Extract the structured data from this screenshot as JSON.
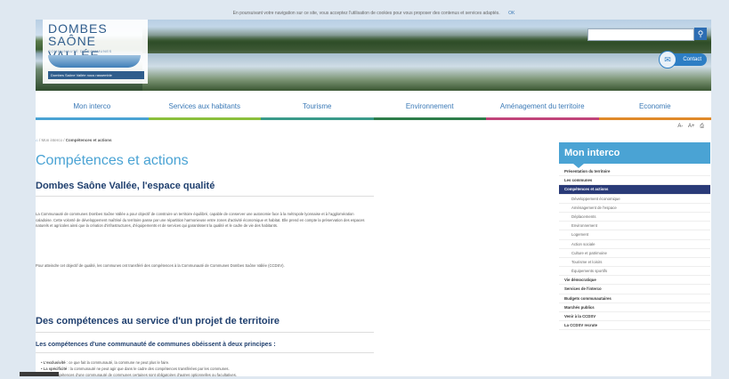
{
  "cookie_notice": {
    "text": "En poursuivant votre navigation sur ce site, vous acceptez l'utilisation de cookies pour vous proposer des contenus et services adaptés.",
    "ok_label": "OK"
  },
  "brand": {
    "line1": "DOMBES",
    "line2": "SAÔNE VALLÉE",
    "subtitle": "COMMUNAUTÉ DE COMMUNES",
    "tagline": "Dombes Saône Vallée nous rassemble"
  },
  "header": {
    "search_placeholder": "",
    "contact_label": "Contact"
  },
  "nav": [
    {
      "label": "Mon interco",
      "color": "#4aa3d4"
    },
    {
      "label": "Services aux habitants",
      "color": "#8bbf3c"
    },
    {
      "label": "Tourisme",
      "color": "#3a9a8a"
    },
    {
      "label": "Environnement",
      "color": "#2e7d4a"
    },
    {
      "label": "Aménagement du territoire",
      "color": "#c0447a"
    },
    {
      "label": "Economie",
      "color": "#e08a2a"
    }
  ],
  "accessibility": {
    "small": "A-",
    "large": "A+",
    "print": "⎙"
  },
  "breadcrumb": {
    "home": "⌂",
    "parent": "Mon interco",
    "current": "Compétences et actions"
  },
  "content": {
    "title": "Compétences et actions",
    "section1_title": "Dombes Saône Vallée, l'espace qualité",
    "para1": "La Communauté de communes Dombes Saône Vallée a pour objectif de construire un territoire équilibré, capable de conserver une autonomie face à la métropole lyonnaise et à l'agglomération caladoise. Cette volonté de développement maîtrisé du territoire passe par une répartition harmonieuse entre zones d'activité économique et habitat. Elle prend en compte la préservation des espaces naturels et agricoles ainsi que la création d'infrastructures, d'équipements et de services qui garantissent la qualité et le cadre de vie des habitants.",
    "para2": "Pour atteindre cet objectif de qualité, les communes ont transféré des compétences à la Communauté de Communes Dombes Saône Vallée (CCDSV).",
    "section2_title": "Des compétences au service d'un projet de territoire",
    "subsection_title": "Les compétences d'une communauté de communes obéissent à deux principes :",
    "bullet1_term": "L'exclusivité",
    "bullet1_text": " : ce que fait la communauté, la commune ne peut plus le faire.",
    "bullet2_term": "La spécificité",
    "bullet2_text": " : la communauté ne peut agir que dans le cadre des compétences transférées par les communes.",
    "para3": "Parmi les compétences d'une communauté de communes certaines sont obligatoires d'autres optionnelles ou facultatives."
  },
  "sidebar": {
    "title": "Mon interco",
    "items": [
      {
        "label": "Présentation du territoire",
        "type": "bold"
      },
      {
        "label": "Les communes",
        "type": "bold"
      },
      {
        "label": "Compétences et actions",
        "type": "active"
      },
      {
        "label": "Développement économique",
        "type": "sub"
      },
      {
        "label": "Aménagement de l'espace",
        "type": "sub"
      },
      {
        "label": "Déplacements",
        "type": "sub"
      },
      {
        "label": "Environnement",
        "type": "sub"
      },
      {
        "label": "Logement",
        "type": "sub"
      },
      {
        "label": "Action sociale",
        "type": "sub"
      },
      {
        "label": "Culture et patrimoine",
        "type": "sub"
      },
      {
        "label": "Tourisme et loisirs",
        "type": "sub"
      },
      {
        "label": "Équipements sportifs",
        "type": "sub"
      },
      {
        "label": "Vie démocratique",
        "type": "bold"
      },
      {
        "label": "Services de l'interco",
        "type": "bold"
      },
      {
        "label": "Budgets communautaires",
        "type": "bold"
      },
      {
        "label": "Marchés publics",
        "type": "bold"
      },
      {
        "label": "Venir à la CCDSV",
        "type": "bold"
      },
      {
        "label": "La CCDSV recrute",
        "type": "bold"
      }
    ]
  }
}
